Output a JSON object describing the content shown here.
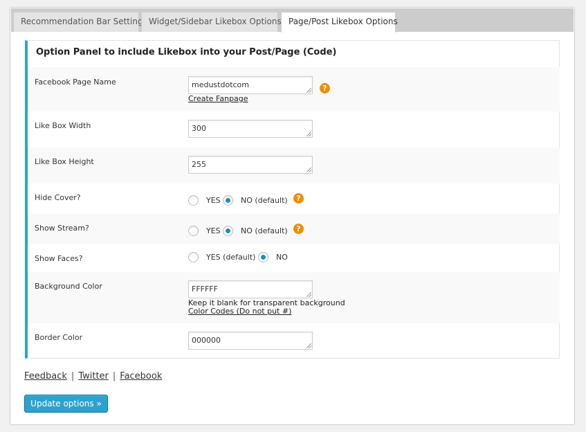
{
  "tabs": [
    {
      "label": "Recommendation Bar Setting",
      "active": false
    },
    {
      "label": "Widget/Sidebar Likebox Options",
      "active": false
    },
    {
      "label": "Page/Post Likebox Options",
      "active": true
    }
  ],
  "panel": {
    "title_prefix": "Option Panel to include Likebox into your Post/Page (",
    "title_link": "Code",
    "title_suffix": ")"
  },
  "fields": {
    "fb_page_name": {
      "label": "Facebook Page Name",
      "value": "medustdotcom",
      "link": "Create Fanpage",
      "help": "?"
    },
    "width": {
      "label": "Like Box Width",
      "value": "300"
    },
    "height": {
      "label": "Like Box Height",
      "value": "255"
    },
    "hide_cover": {
      "label": "Hide Cover?",
      "yes": "YES",
      "no": "NO (default)",
      "selected": "no",
      "help": "?"
    },
    "show_stream": {
      "label": "Show Stream?",
      "yes": "YES",
      "no": "NO (default)",
      "selected": "no",
      "help": "?"
    },
    "show_faces": {
      "label": "Show Faces?",
      "yes": "YES (default)",
      "no": "NO",
      "selected": "no"
    },
    "bg_color": {
      "label": "Background Color",
      "value": "FFFFFF",
      "note": "Keep it blank for transparent background",
      "link": "Color Codes (Do not put #)"
    },
    "border_color": {
      "label": "Border Color",
      "value": "000000"
    }
  },
  "footer": {
    "links": [
      "Feedback",
      "Twitter",
      "Facebook"
    ],
    "separator": "|"
  },
  "update_button": "Update options »",
  "colors": {
    "accent": "#2ea2cc",
    "help": "#f38c00",
    "radio": "#1e8cbe"
  }
}
